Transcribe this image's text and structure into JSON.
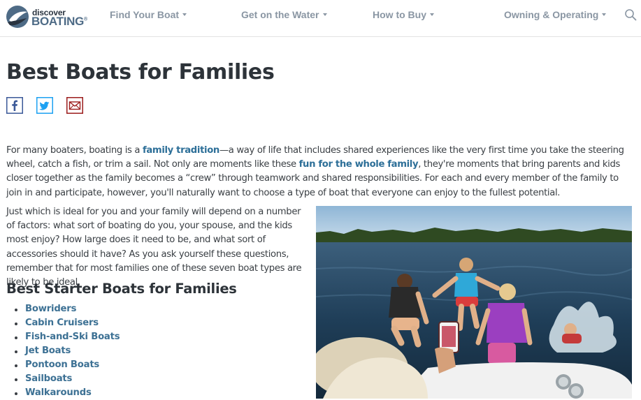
{
  "header": {
    "logo": {
      "small": "discover",
      "big": "BOATING",
      "reg": "®"
    },
    "nav": [
      {
        "label": "Find Your Boat"
      },
      {
        "label": "Get on the Water"
      },
      {
        "label": "How to Buy"
      },
      {
        "label": "Owning & Operating"
      }
    ],
    "icons": {
      "search": "search-icon",
      "dropdown": "chevron-down-icon"
    }
  },
  "article": {
    "title": "Best Boats for Families",
    "share": [
      {
        "name": "facebook-icon",
        "color": "#3b5998"
      },
      {
        "name": "twitter-icon",
        "color": "#1da1f2"
      },
      {
        "name": "email-icon",
        "color": "#9b1c1c"
      }
    ],
    "intro": {
      "t1": "For many boaters, boating is a ",
      "link1": "family tradition",
      "t2": "—a way of life that includes shared experiences like the very first time you take the steering wheel, catch a fish, or trim a sail. Not only are moments like these ",
      "link2": "fun for the whole family",
      "t3": ", they're moments that bring parents and kids closer together as the family becomes a “crew” through teamwork and shared responsibilities. For each and every member of the family to join in and participate, however, you'll naturally want to choose a type of boat that everyone can enjoy to the fullest potential."
    },
    "paragraph2": "Just which is ideal for you and your family will depend on a number of factors: what sort of boating do you, your spouse, and the kids most enjoy? How large does it need to be, and what sort of accessories should it have? As you ask yourself these questions, remember that for most families one of these seven boat types are likely to be ideal.",
    "subheading": "Best Starter Boats for Families",
    "boat_types": [
      {
        "label": "Bowriders"
      },
      {
        "label": "Cabin Cruisers"
      },
      {
        "label": "Fish-and-Ski Boats"
      },
      {
        "label": "Jet Boats"
      },
      {
        "label": "Pontoon Boats"
      },
      {
        "label": "Sailboats"
      },
      {
        "label": "Walkarounds"
      }
    ]
  },
  "colors": {
    "link": "#2d6f98",
    "nav": "#8a96a3",
    "logo_blue": "#4e6b86"
  }
}
